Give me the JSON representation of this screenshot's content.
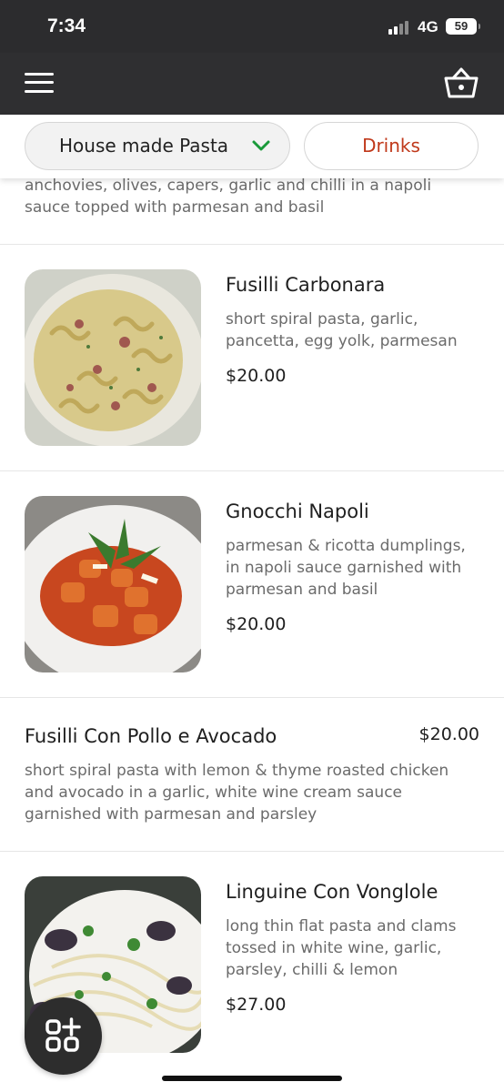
{
  "status": {
    "time": "7:34",
    "network": "4G",
    "battery": "59"
  },
  "nav": {
    "menu_icon": "hamburger-menu-icon",
    "cart_icon": "basket-icon"
  },
  "categories": [
    {
      "label": "House made Pasta",
      "active": true
    },
    {
      "label": "Drinks",
      "active": false
    }
  ],
  "colors": {
    "status_bg": "#2c2c2e",
    "nav_bg": "#2f2f31",
    "accent_green": "#1a9a3a",
    "drinks_red": "#c0391b"
  },
  "partial_item": {
    "description": "anchovies, olives, capers, garlic and chilli in a napoli sauce topped with parmesan and basil"
  },
  "items": [
    {
      "name": "Fusilli Carbonara",
      "description": "short spiral pasta, garlic, pancetta, egg yolk, parmesan",
      "price": "$20.00",
      "has_image": true
    },
    {
      "name": "Gnocchi Napoli",
      "description": "parmesan & ricotta dumplings, in napoli sauce garnished with parmesan and basil",
      "price": "$20.00",
      "has_image": true
    },
    {
      "name": "Fusilli Con Pollo e Avocado",
      "description": "short spiral pasta with lemon & thyme roasted chicken and avocado in a garlic, white wine cream sauce garnished with parmesan and parsley",
      "price": "$20.00",
      "has_image": false
    },
    {
      "name": "Linguine Con Vonglole",
      "description": "long thin flat pasta and clams tossed in white wine, garlic, parsley, chilli & lemon",
      "price": "$27.00",
      "has_image": true
    }
  ],
  "fab": {
    "icon": "add-apps-icon"
  }
}
